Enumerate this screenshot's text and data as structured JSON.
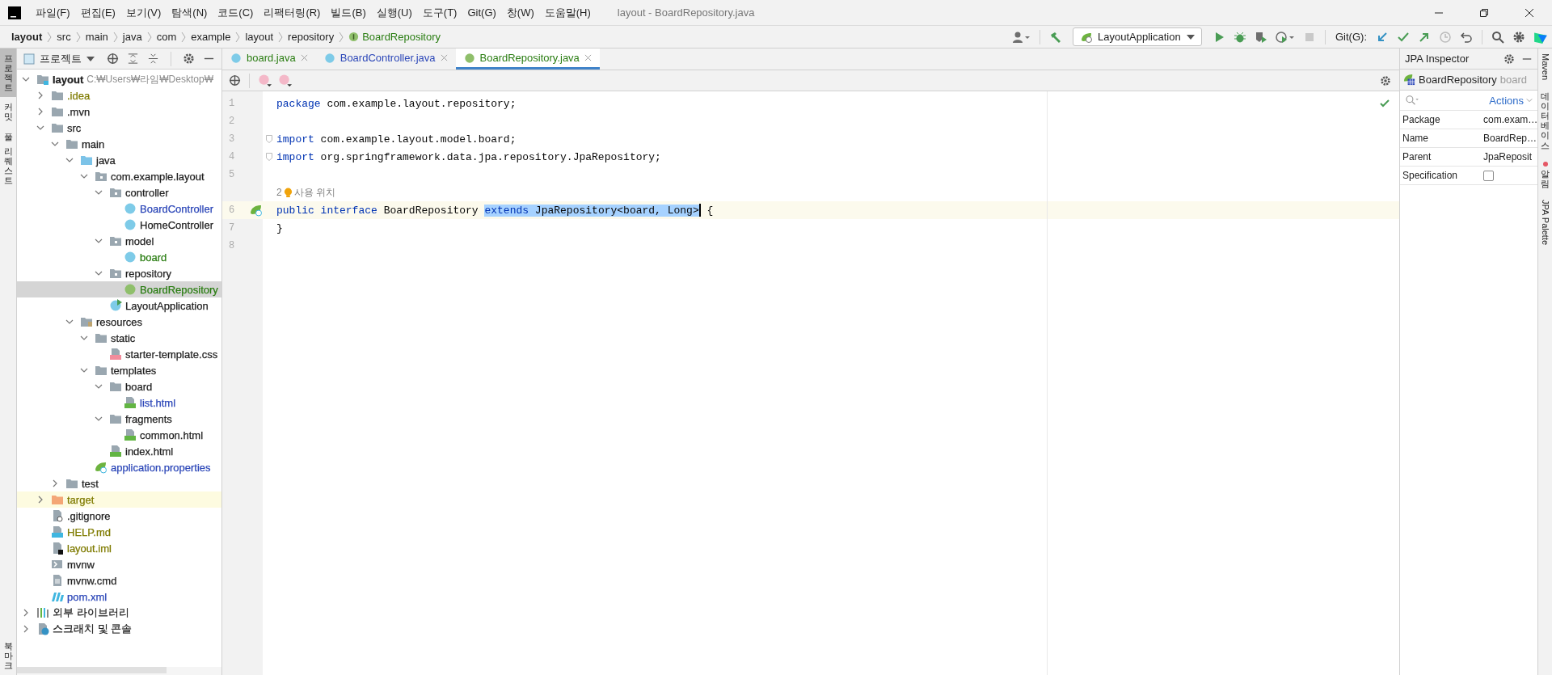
{
  "window": {
    "title": "layout - BoardRepository.java"
  },
  "menu": [
    "파일(F)",
    "편집(E)",
    "보기(V)",
    "탐색(N)",
    "코드(C)",
    "리팩터링(R)",
    "빌드(B)",
    "실행(U)",
    "도구(T)",
    "Git(G)",
    "창(W)",
    "도움말(H)"
  ],
  "breadcrumb": [
    {
      "label": "layout",
      "kind": "module"
    },
    {
      "label": "src",
      "kind": "dir"
    },
    {
      "label": "main",
      "kind": "dir"
    },
    {
      "label": "java",
      "kind": "dir"
    },
    {
      "label": "com",
      "kind": "dir"
    },
    {
      "label": "example",
      "kind": "dir"
    },
    {
      "label": "layout",
      "kind": "dir"
    },
    {
      "label": "repository",
      "kind": "dir"
    },
    {
      "label": "BoardRepository",
      "kind": "interface"
    }
  ],
  "toolbar": {
    "run_configuration": "LayoutApplication",
    "git_label": "Git(G):"
  },
  "tool_strip_left": [
    {
      "label": "프로젝트",
      "selected": true
    },
    {
      "label": "커밋",
      "selected": false
    },
    {
      "label": "풀 리퀘스트",
      "selected": false
    }
  ],
  "tool_strip_left_bottom": [
    {
      "label": "북마크",
      "selected": false
    }
  ],
  "project": {
    "title": "프로젝트",
    "tree": [
      {
        "name": "layout",
        "path": "C:₩Users₩라임₩Desktop₩",
        "kind": "module",
        "color": "#1f1f1f",
        "expanded": true,
        "selected": false,
        "children": [
          {
            "name": ".idea",
            "kind": "folder",
            "color": "#7f7b00",
            "expanded": false,
            "selected": false
          },
          {
            "name": ".mvn",
            "kind": "folder",
            "color": "#1f1f1f",
            "expanded": false,
            "selected": false
          },
          {
            "name": "src",
            "kind": "folder",
            "color": "#1f1f1f",
            "expanded": true,
            "selected": false,
            "children": [
              {
                "name": "main",
                "kind": "folder",
                "color": "#1f1f1f",
                "expanded": true,
                "selected": false,
                "children": [
                  {
                    "name": "java",
                    "kind": "source-folder",
                    "color": "#1f1f1f",
                    "expanded": true,
                    "selected": false,
                    "children": [
                      {
                        "name": "com.example.layout",
                        "kind": "package",
                        "color": "#1f1f1f",
                        "expanded": true,
                        "selected": false,
                        "children": [
                          {
                            "name": "controller",
                            "kind": "package",
                            "color": "#1f1f1f",
                            "expanded": true,
                            "selected": false,
                            "children": [
                              {
                                "name": "BoardController",
                                "kind": "class",
                                "color": "#2c47b8",
                                "selected": false
                              },
                              {
                                "name": "HomeController",
                                "kind": "class",
                                "color": "#1f1f1f",
                                "selected": false
                              }
                            ]
                          },
                          {
                            "name": "model",
                            "kind": "package",
                            "color": "#1f1f1f",
                            "expanded": true,
                            "selected": false,
                            "children": [
                              {
                                "name": "board",
                                "kind": "class",
                                "color": "#2a7d12",
                                "selected": false
                              }
                            ]
                          },
                          {
                            "name": "repository",
                            "kind": "package",
                            "color": "#1f1f1f",
                            "expanded": true,
                            "selected": false,
                            "children": [
                              {
                                "name": "BoardRepository",
                                "kind": "interface",
                                "color": "#2a7d12",
                                "selected": true
                              }
                            ]
                          },
                          {
                            "name": "LayoutApplication",
                            "kind": "spring-class",
                            "color": "#1f1f1f",
                            "selected": false
                          }
                        ]
                      }
                    ]
                  },
                  {
                    "name": "resources",
                    "kind": "resources-folder",
                    "color": "#1f1f1f",
                    "expanded": true,
                    "selected": false,
                    "children": [
                      {
                        "name": "static",
                        "kind": "folder",
                        "color": "#1f1f1f",
                        "expanded": true,
                        "selected": false,
                        "children": [
                          {
                            "name": "starter-template.css",
                            "kind": "css",
                            "color": "#1f1f1f",
                            "selected": false
                          }
                        ]
                      },
                      {
                        "name": "templates",
                        "kind": "folder",
                        "color": "#1f1f1f",
                        "expanded": true,
                        "selected": false,
                        "children": [
                          {
                            "name": "board",
                            "kind": "folder",
                            "color": "#1f1f1f",
                            "expanded": true,
                            "selected": false,
                            "children": [
                              {
                                "name": "list.html",
                                "kind": "html",
                                "color": "#2c47b8",
                                "selected": false
                              }
                            ]
                          },
                          {
                            "name": "fragments",
                            "kind": "folder",
                            "color": "#1f1f1f",
                            "expanded": true,
                            "selected": false,
                            "children": [
                              {
                                "name": "common.html",
                                "kind": "html",
                                "color": "#1f1f1f",
                                "selected": false
                              }
                            ]
                          },
                          {
                            "name": "index.html",
                            "kind": "html",
                            "color": "#1f1f1f",
                            "selected": false
                          }
                        ]
                      },
                      {
                        "name": "application.properties",
                        "kind": "properties",
                        "color": "#2c47b8",
                        "selected": false
                      }
                    ]
                  }
                ]
              },
              {
                "name": "test",
                "kind": "folder",
                "color": "#1f1f1f",
                "expanded": false,
                "selected": false
              }
            ]
          },
          {
            "name": "target",
            "kind": "excluded-folder",
            "color": "#7f7b00",
            "expanded": false,
            "selected": false
          },
          {
            "name": ".gitignore",
            "kind": "gitignore",
            "color": "#1f1f1f",
            "selected": false
          },
          {
            "name": "HELP.md",
            "kind": "md",
            "color": "#7f7b00",
            "selected": false
          },
          {
            "name": "layout.iml",
            "kind": "iml",
            "color": "#7f7b00",
            "selected": false
          },
          {
            "name": "mvnw",
            "kind": "mvnw",
            "color": "#1f1f1f",
            "selected": false
          },
          {
            "name": "mvnw.cmd",
            "kind": "cmd",
            "color": "#1f1f1f",
            "selected": false
          },
          {
            "name": "pom.xml",
            "kind": "maven",
            "color": "#2c47b8",
            "selected": false
          }
        ]
      },
      {
        "name": "외부 라이브러리",
        "kind": "library",
        "expanded": false,
        "selected": false
      },
      {
        "name": "스크래치 및 콘솔",
        "kind": "scratch",
        "expanded": false,
        "selected": false
      }
    ]
  },
  "editor": {
    "tabs": [
      {
        "label": "board.java",
        "kind": "class",
        "color": "#2a7d12",
        "selected": false
      },
      {
        "label": "BoardController.java",
        "kind": "class",
        "color": "#2c47b8",
        "selected": false
      },
      {
        "label": "BoardRepository.java",
        "kind": "interface",
        "color": "#2a7d12",
        "selected": true
      }
    ],
    "lines": [
      {
        "number": "1",
        "current": false,
        "kind": "plain",
        "tokens": [
          {
            "text": "package",
            "kind": "keyword",
            "selected": false
          },
          {
            "text": " com.example.layout.repository;",
            "kind": "plain",
            "selected": false
          }
        ]
      },
      {
        "number": "2",
        "current": false,
        "kind": "plain"
      },
      {
        "number": "3",
        "current": false,
        "kind": "fold",
        "tokens": [
          {
            "text": "import",
            "kind": "keyword",
            "selected": false
          },
          {
            "text": " com.example.layout.model.board;",
            "kind": "plain",
            "selected": false
          }
        ]
      },
      {
        "number": "4",
        "current": false,
        "kind": "fold",
        "tokens": [
          {
            "text": "import",
            "kind": "keyword",
            "selected": false
          },
          {
            "text": " org.springframework.data.jpa.repository.JpaRepository;",
            "kind": "plain",
            "selected": false
          }
        ]
      },
      {
        "number": "5",
        "current": false,
        "kind": "plain"
      },
      {
        "number": "6",
        "current": true,
        "kind": "implemented",
        "usage_hint": {
          "count": "2",
          "text": "사용 위치"
        },
        "tokens": [
          {
            "text": "public interface",
            "kind": "keyword",
            "selected": false
          },
          {
            "text": " BoardRepository ",
            "kind": "plain",
            "selected": false
          },
          {
            "text": "extends",
            "kind": "keyword",
            "selected": true
          },
          {
            "text": " JpaRepository<board, Long>",
            "kind": "plain",
            "selected": true,
            "caret": true
          },
          {
            "text": " {",
            "kind": "plain",
            "selected": false
          }
        ]
      },
      {
        "number": "7",
        "current": false,
        "kind": "plain",
        "tokens": [
          {
            "text": "}",
            "kind": "plain",
            "selected": false
          }
        ]
      },
      {
        "number": "8",
        "current": false,
        "kind": "plain"
      }
    ]
  },
  "jpa_inspector": {
    "title": "JPA Inspector",
    "entity": "BoardRepository",
    "entity_type": "board",
    "actions": "Actions",
    "rows": [
      {
        "label": "Package",
        "kind": "text",
        "value": "com.exam…"
      },
      {
        "label": "Name",
        "kind": "text",
        "value": "BoardRep…"
      },
      {
        "label": "Parent",
        "kind": "text",
        "value": "JpaReposit"
      },
      {
        "label": "Specification",
        "kind": "checkbox",
        "checked": false
      }
    ]
  },
  "tool_strip_right": [
    {
      "label": "Maven",
      "badge": false
    },
    {
      "label": "데이터베이스",
      "badge": false
    },
    {
      "label": "알림",
      "badge": true
    },
    {
      "label": "JPA Palette",
      "badge": false
    }
  ]
}
